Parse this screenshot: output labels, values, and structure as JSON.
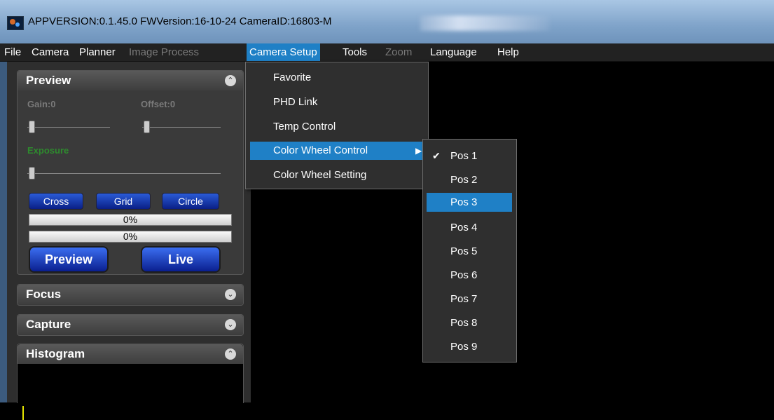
{
  "window": {
    "title": "APPVERSION:0.1.45.0  FWVersion:16-10-24  CameraID:16803-M"
  },
  "menubar": {
    "items": [
      {
        "label": "File",
        "enabled": true
      },
      {
        "label": "Camera",
        "enabled": true
      },
      {
        "label": "Planner",
        "enabled": true
      },
      {
        "label": "Image Process",
        "enabled": false
      },
      {
        "label": "Camera Setup",
        "enabled": true,
        "active": true
      },
      {
        "label": "Tools",
        "enabled": true
      },
      {
        "label": "Zoom",
        "enabled": false
      },
      {
        "label": "Language",
        "enabled": true
      },
      {
        "label": "Help",
        "enabled": true
      }
    ]
  },
  "camera_setup_menu": {
    "items": [
      "Favorite",
      "PHD Link",
      "Temp Control",
      "Color Wheel Control",
      "Color Wheel Setting"
    ],
    "highlighted": "Color Wheel Control"
  },
  "color_wheel_submenu": {
    "items": [
      "Pos 1",
      "Pos 2",
      "Pos 3",
      "Pos 4",
      "Pos 5",
      "Pos 6",
      "Pos 7",
      "Pos 8",
      "Pos 9"
    ],
    "checked": "Pos 1",
    "highlighted": "Pos 3"
  },
  "preview_panel": {
    "title": "Preview",
    "gain_label": "Gain:0",
    "offset_label": "Offset:0",
    "exposure_label": "Exposure",
    "cross_button": "Cross",
    "grid_button": "Grid",
    "circle_button": "Circle",
    "progress1": "0%",
    "progress2": "0%",
    "preview_button": "Preview",
    "live_button": "Live"
  },
  "focus_panel": {
    "title": "Focus"
  },
  "capture_panel": {
    "title": "Capture"
  },
  "histogram_panel": {
    "title": "Histogram"
  },
  "colors": {
    "accent": "#1f80c6",
    "exposure_label": "#2e8b2e",
    "histogram_line": "#e6e600"
  }
}
